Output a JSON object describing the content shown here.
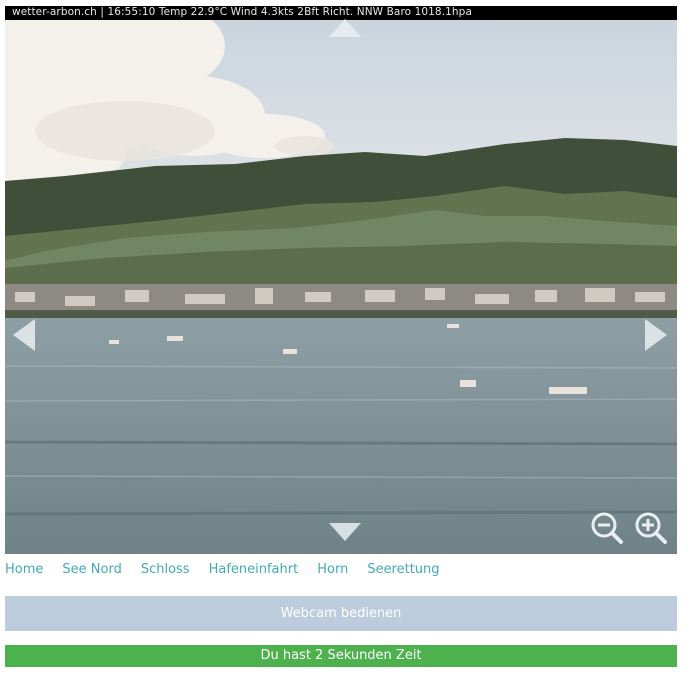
{
  "webcam": {
    "overlay_text": "wetter-arbon.ch | 16:55:10 Temp 22.9°C Wind 4.3kts 2Bft Richt. NNW Baro 1018.1hpa",
    "controls": {
      "pan_up": "arrow-up-icon",
      "pan_down": "arrow-down-icon",
      "pan_left": "arrow-left-icon",
      "pan_right": "arrow-right-icon",
      "zoom_out": "zoom-out-icon",
      "zoom_in": "zoom-in-icon"
    }
  },
  "nav": {
    "items": [
      {
        "label": "Home"
      },
      {
        "label": "See Nord"
      },
      {
        "label": "Schloss"
      },
      {
        "label": "Hafeneinfahrt"
      },
      {
        "label": "Horn"
      },
      {
        "label": "Seerettung"
      }
    ]
  },
  "control_button": {
    "label": "Webcam bedienen"
  },
  "timer": {
    "label": "Du hast 2 Sekunden Zeit"
  },
  "colors": {
    "nav_link": "#43a9ba",
    "control_button_bg": "#bcccdc",
    "timer_bg": "#4db14d"
  }
}
